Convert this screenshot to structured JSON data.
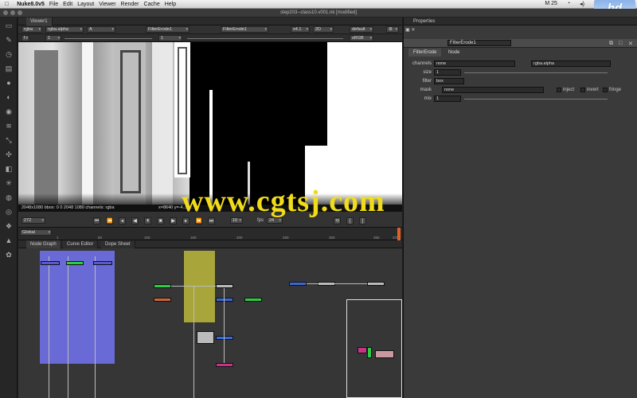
{
  "menubar": {
    "app": "Nuke8.0v5",
    "items": [
      "File",
      "Edit",
      "Layout",
      "Viewer",
      "Render",
      "Cache",
      "Help"
    ],
    "date_status": "M 25"
  },
  "logo": "hd",
  "window_title": "step203--class10.v001.nk [modified]",
  "viewer": {
    "tab": "Viewer1",
    "channels": "rgba",
    "alpha": "rgba.alpha",
    "input_a": "A",
    "input_a_node": "FilterErode1",
    "input_b_node": "FilterErode1",
    "gain": "1",
    "zoom": "x4.1",
    "mode": "2D",
    "lut": "default",
    "display": "sRGB",
    "proxy_frame": "1"
  },
  "infobar": {
    "format": "2048x1080 bbox: 0 0 2048 1080 channels: rgba",
    "coords": "x=8640 y=-4..9 ..."
  },
  "timeline": {
    "frame": "272",
    "fps_label": "fps",
    "fps": "24",
    "increment": "10",
    "range_label": "Global"
  },
  "ruler_ticks": [
    "1",
    "50",
    "100",
    "150",
    "200",
    "250",
    "300",
    "350",
    "375"
  ],
  "dag_tabs": [
    "Node Graph",
    "Curve Editor",
    "Dope Sheet"
  ],
  "properties": {
    "title": "Properties",
    "node_name": "FilterErode1",
    "tabs": [
      "FilterErode",
      "Node"
    ],
    "channels_label": "channels",
    "channels_value": "none",
    "alpha_value": "rgba.alpha",
    "size_label": "size",
    "size_value": "1",
    "filter_label": "filter",
    "filter_value": "box",
    "mask_label": "mask",
    "mask_value": "none",
    "inject": "inject",
    "invert": "invert",
    "fringe": "fringe",
    "mix_label": "mix",
    "mix_value": "1"
  },
  "watermark": "www.cgtsj.com",
  "colors": {
    "yellow": "#f1dc1a",
    "backdrop_blue": "#6a6ad6",
    "backdrop_olive": "#a8a63a"
  }
}
